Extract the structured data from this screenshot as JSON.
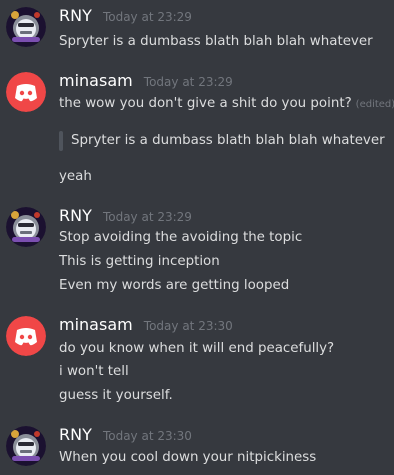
{
  "messages": [
    {
      "author": "RNY",
      "timestamp": "Today at 23:29",
      "avatar": "skull-bomb-avatar",
      "lines": [
        "Spryter is a dumbass blath blah blah whatever"
      ]
    },
    {
      "author": "minasam",
      "timestamp": "Today at 23:29",
      "avatar": "discord-logo-avatar",
      "lines": [
        "the wow you don't give a shit do you point?"
      ],
      "edited_label": "(edited)",
      "quote": "Spryter is a dumbass blath blah blah whatever",
      "after_quote": [
        "yeah"
      ]
    },
    {
      "author": "RNY",
      "timestamp": "Today at 23:29",
      "avatar": "skull-bomb-avatar",
      "lines": [
        "Stop avoiding the avoiding the topic",
        "This is getting inception",
        "Even my words are getting looped"
      ]
    },
    {
      "author": "minasam",
      "timestamp": "Today at 23:30",
      "avatar": "discord-logo-avatar",
      "lines": [
        "do you know when it will end peacefully?",
        "i won't tell",
        "guess it yourself."
      ]
    },
    {
      "author": "RNY",
      "timestamp": "Today at 23:30",
      "avatar": "skull-bomb-avatar",
      "lines": [
        "When you cool down your nitpickiness"
      ]
    }
  ],
  "colors": {
    "background": "#36393f",
    "username": "#ffffff",
    "timestamp": "#72767d",
    "text": "#dcddde",
    "quote_bar": "#4f545c",
    "discord_avatar": "#f04747"
  }
}
